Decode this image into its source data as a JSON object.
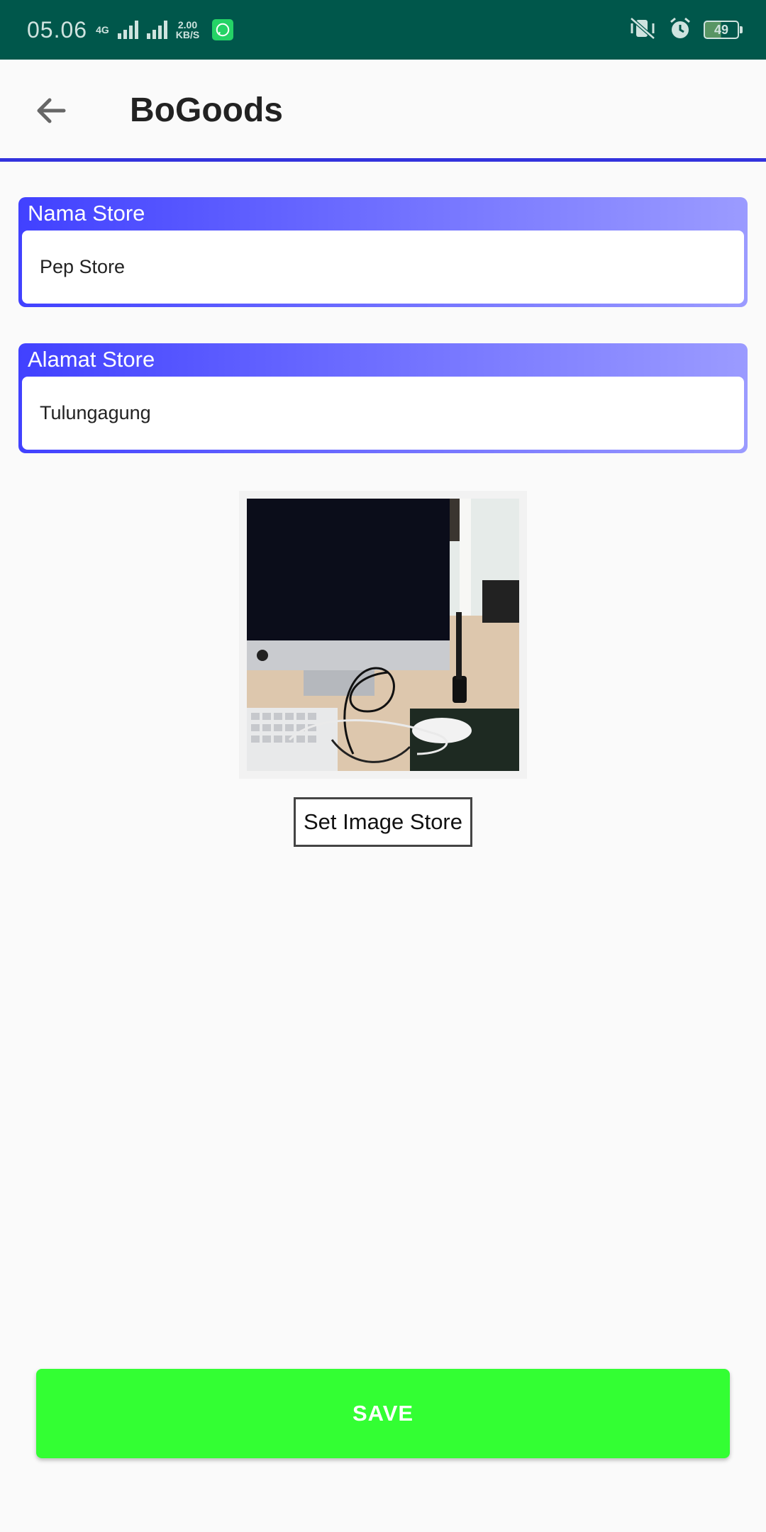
{
  "status_bar": {
    "time": "05.06",
    "network_type": "4G",
    "speed_value": "2.00",
    "speed_unit": "KB/S",
    "battery": "49",
    "icons": [
      "signal-icon",
      "whatsapp-icon",
      "vibrate-icon",
      "alarm-icon",
      "battery-icon"
    ]
  },
  "app_bar": {
    "title": "BoGoods",
    "back_icon": "arrow-back-icon"
  },
  "form": {
    "store_name": {
      "label": "Nama Store",
      "value": "Pep Store"
    },
    "store_address": {
      "label": "Alamat Store",
      "value": "Tulungagung"
    },
    "gradient_colors": [
      "#4141ff",
      "#9b9bff"
    ]
  },
  "image_section": {
    "button_label": "Set Image Store"
  },
  "actions": {
    "save_label": "SAVE",
    "save_color": "#33ff33"
  }
}
